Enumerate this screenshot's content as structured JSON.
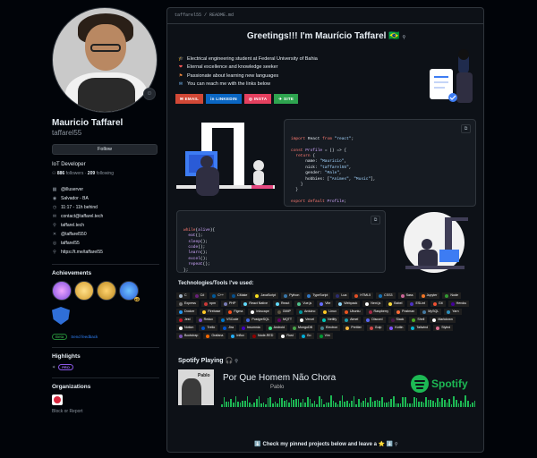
{
  "profile": {
    "name": "Mauricio Taffarel",
    "login": "taffarel55",
    "follow_label": "Follow",
    "bio": "IoT Developer",
    "followers_count": "886",
    "followers_label": "followers",
    "following_count": "209",
    "following_label": "following",
    "details": [
      {
        "icon": "organization-icon",
        "glyph": "▦",
        "text": "@illuserver"
      },
      {
        "icon": "location-icon",
        "glyph": "◉",
        "text": "Salvador - BA"
      },
      {
        "icon": "clock-icon",
        "glyph": "◷",
        "text": "11:17 - 11h behind"
      },
      {
        "icon": "mail-icon",
        "glyph": "✉",
        "text": "contact@taffarel.tech"
      },
      {
        "icon": "link-icon",
        "glyph": "⚲",
        "text": "taffarel.tech"
      },
      {
        "icon": "twitter-icon",
        "glyph": "✕",
        "text": "@taffarel550"
      },
      {
        "icon": "instagram-icon",
        "glyph": "◎",
        "text": "taffarel55"
      },
      {
        "icon": "link-icon",
        "glyph": "⚲",
        "text": "https://t.me/taffarel55"
      }
    ],
    "achievements_title": "Achievements",
    "achievement_count": "x2",
    "beta_pill": "Beta",
    "beta_link": "Send feedback",
    "highlights_title": "Highlights",
    "pro_pill": "PRO",
    "organizations_title": "Organizations",
    "block_report": "Block or Report"
  },
  "readme": {
    "path": "taffarel55 / README.md",
    "heading": "Greetings!!! I'm Maurício Taffarel 🇧🇷",
    "bullets": [
      {
        "emoji": "🎓",
        "color": "#f0c674",
        "text": "Electrical engineering student at Federal University of Bahia"
      },
      {
        "emoji": "❤",
        "color": "#ff5a5a",
        "text": "Eternal excellence and knowledge seeker"
      },
      {
        "emoji": "⚑",
        "color": "#f0883e",
        "text": "Passionate about learning new languages"
      },
      {
        "emoji": "✉",
        "color": "#79c0ff",
        "text": "You can reach me with the links below"
      }
    ],
    "badges": [
      {
        "label": "✉ EMAIL",
        "color": "#d14836"
      },
      {
        "label": "in LINKEDIN",
        "color": "#0a66c2"
      },
      {
        "label": "◎ INSTA",
        "color": "#e4405f"
      },
      {
        "label": "✈ SITE",
        "color": "#2ea44f"
      }
    ],
    "code1": [
      [
        {
          "c": "kw",
          "t": "import "
        },
        {
          "c": "pl",
          "t": "React "
        },
        {
          "c": "kw",
          "t": "from "
        },
        {
          "c": "str",
          "t": "\"react\""
        },
        {
          "c": "pl",
          "t": ";"
        }
      ],
      [
        {
          "c": "pl",
          "t": ""
        }
      ],
      [
        {
          "c": "kw",
          "t": "const "
        },
        {
          "c": "fn",
          "t": "Profile "
        },
        {
          "c": "pl",
          "t": "= () => {"
        }
      ],
      [
        {
          "c": "kw",
          "t": "  return "
        },
        {
          "c": "pl",
          "t": "{"
        }
      ],
      [
        {
          "c": "pl",
          "t": "      name: "
        },
        {
          "c": "str",
          "t": "\"Maurício\""
        },
        {
          "c": "pl",
          "t": ","
        }
      ],
      [
        {
          "c": "pl",
          "t": "      nick: "
        },
        {
          "c": "str",
          "t": "\"taffarel55\""
        },
        {
          "c": "pl",
          "t": ","
        }
      ],
      [
        {
          "c": "pl",
          "t": "      gender: "
        },
        {
          "c": "str",
          "t": "\"Male\""
        },
        {
          "c": "pl",
          "t": ","
        }
      ],
      [
        {
          "c": "pl",
          "t": "      hobbies: ["
        },
        {
          "c": "str",
          "t": "\"Animes\""
        },
        {
          "c": "pl",
          "t": ", "
        },
        {
          "c": "str",
          "t": "\"Music\""
        },
        {
          "c": "pl",
          "t": "],"
        }
      ],
      [
        {
          "c": "pl",
          "t": "    }"
        }
      ],
      [
        {
          "c": "pl",
          "t": "  }"
        }
      ],
      [
        {
          "c": "pl",
          "t": ""
        }
      ],
      [
        {
          "c": "kw",
          "t": "export default "
        },
        {
          "c": "fn",
          "t": "Profile"
        },
        {
          "c": "pl",
          "t": ";"
        }
      ]
    ],
    "code2": [
      [
        {
          "c": "kw",
          "t": "while"
        },
        {
          "c": "pl",
          "t": "("
        },
        {
          "c": "fn",
          "t": "alive"
        },
        {
          "c": "pl",
          "t": "){"
        }
      ],
      [
        {
          "c": "fn",
          "t": "  eat"
        },
        {
          "c": "pl",
          "t": "();"
        }
      ],
      [
        {
          "c": "fn",
          "t": "  sleep"
        },
        {
          "c": "pl",
          "t": "();"
        }
      ],
      [
        {
          "c": "fn",
          "t": "  code"
        },
        {
          "c": "pl",
          "t": "();"
        }
      ],
      [
        {
          "c": "fn",
          "t": "  learn"
        },
        {
          "c": "pl",
          "t": "();"
        }
      ],
      [
        {
          "c": "fn",
          "t": "  excel"
        },
        {
          "c": "pl",
          "t": "();"
        }
      ],
      [
        {
          "c": "fn",
          "t": "  repeat"
        },
        {
          "c": "pl",
          "t": "();"
        }
      ],
      [
        {
          "c": "pl",
          "t": "};"
        }
      ]
    ],
    "tech_title": "Technologies/Tools I've used:",
    "tech": [
      {
        "n": "C",
        "c": "#a8b9cc"
      },
      {
        "n": "C#",
        "c": "#68217a"
      },
      {
        "n": "C++",
        "c": "#00599c"
      },
      {
        "n": "CMake",
        "c": "#064f8c"
      },
      {
        "n": "JavaScript",
        "c": "#f7df1e"
      },
      {
        "n": "Python",
        "c": "#3776ab"
      },
      {
        "n": "TypeScript",
        "c": "#3178c6"
      },
      {
        "n": "Lua",
        "c": "#2c2d72"
      },
      {
        "n": "HTML5",
        "c": "#e34f26"
      },
      {
        "n": "CSS3",
        "c": "#1572b6"
      },
      {
        "n": "Sass",
        "c": "#cc6699"
      },
      {
        "n": "Jupyter",
        "c": "#f37626"
      },
      {
        "n": "Node",
        "c": "#339933"
      },
      {
        "n": "Express",
        "c": "#777777"
      },
      {
        "n": "npm",
        "c": "#cb3837"
      },
      {
        "n": "PHP",
        "c": "#777bb4"
      },
      {
        "n": "React Native",
        "c": "#61dafb"
      },
      {
        "n": "React",
        "c": "#61dafb"
      },
      {
        "n": "Vue.js",
        "c": "#4fc08d"
      },
      {
        "n": "Vite",
        "c": "#646cff"
      },
      {
        "n": "Webpack",
        "c": "#8dd6f9"
      },
      {
        "n": "Next.js",
        "c": "#ffffff"
      },
      {
        "n": "Babel",
        "c": "#f9dc3e"
      },
      {
        "n": "ESLint",
        "c": "#4b32c3"
      },
      {
        "n": "Git",
        "c": "#f05032"
      },
      {
        "n": "Heroku",
        "c": "#430098"
      },
      {
        "n": "Docker",
        "c": "#2496ed"
      },
      {
        "n": "Firebase",
        "c": "#ffca28"
      },
      {
        "n": "Figma",
        "c": "#f24e1e"
      },
      {
        "n": "Inkscape",
        "c": "#ffffff"
      },
      {
        "n": "GIMP",
        "c": "#5c5543"
      },
      {
        "n": "Arduino",
        "c": "#00979d"
      },
      {
        "n": "Linux",
        "c": "#fcc624"
      },
      {
        "n": "Ubuntu",
        "c": "#e95420"
      },
      {
        "n": "Raspberry",
        "c": "#a22846"
      },
      {
        "n": "Postman",
        "c": "#ff6c37"
      },
      {
        "n": "MySQL",
        "c": "#4479a1"
      },
      {
        "n": "Yarn",
        "c": "#2c8ebb"
      },
      {
        "n": "Jest",
        "c": "#c21325"
      },
      {
        "n": "Redux",
        "c": "#764abc"
      },
      {
        "n": "VSCode",
        "c": "#007acc"
      },
      {
        "n": "PostgreSQL",
        "c": "#4169e1"
      },
      {
        "n": "MQTT",
        "c": "#660066"
      },
      {
        "n": "Vercel",
        "c": "#ffffff"
      },
      {
        "n": "Netlify",
        "c": "#00c7b7"
      },
      {
        "n": "Atmel",
        "c": "#1b9aaa"
      },
      {
        "n": "Discord",
        "c": "#5865f2"
      },
      {
        "n": "Slack",
        "c": "#4a154b"
      },
      {
        "n": "Shell",
        "c": "#4eaa25"
      },
      {
        "n": "Markdown",
        "c": "#ffffff"
      },
      {
        "n": "Notion",
        "c": "#ffffff"
      },
      {
        "n": "Trello",
        "c": "#0052cc"
      },
      {
        "n": "Jira",
        "c": "#0052cc"
      },
      {
        "n": "Insomnia",
        "c": "#4000bf"
      },
      {
        "n": "Android",
        "c": "#3ddc84"
      },
      {
        "n": "MongoDB",
        "c": "#47a248"
      },
      {
        "n": "Electron",
        "c": "#47848f"
      },
      {
        "n": "Prettier",
        "c": "#f7b93e"
      },
      {
        "n": "Gulp",
        "c": "#cf4647"
      },
      {
        "n": "Kotlin",
        "c": "#7f52ff"
      },
      {
        "n": "Tailwind",
        "c": "#06b6d4"
      },
      {
        "n": "Styled",
        "c": "#db7093"
      },
      {
        "n": "Bootstrap",
        "c": "#7952b3"
      },
      {
        "n": "Grafana",
        "c": "#f46800"
      },
      {
        "n": "Influx",
        "c": "#22adf6"
      },
      {
        "n": "Node-RED",
        "c": "#8f0000"
      },
      {
        "n": "Rust",
        "c": "#ffffff"
      },
      {
        "n": "Go",
        "c": "#00add8"
      },
      {
        "n": "Vim",
        "c": "#019733"
      }
    ],
    "spotify_title": "Spotify Playing 🎧",
    "song": "Por Que Homem Não Chora",
    "artist": "Pablo",
    "cover_text": "Pablo",
    "spotify_word": "Spotify",
    "footer": "⬇️ Check my pinned projects below and leave a ⭐️ ⬇️"
  }
}
